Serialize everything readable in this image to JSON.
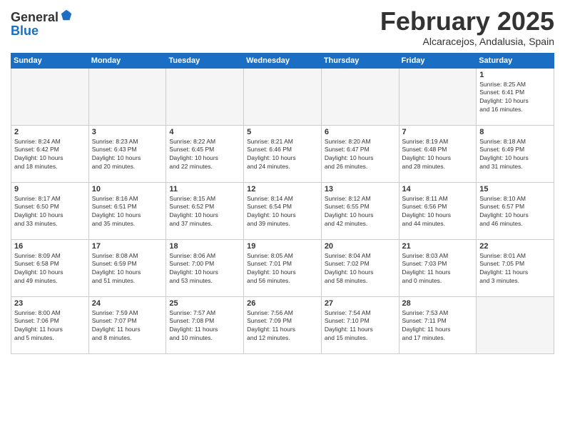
{
  "header": {
    "logo_line1": "General",
    "logo_line2": "Blue",
    "month_title": "February 2025",
    "location": "Alcaracejos, Andalusia, Spain"
  },
  "weekdays": [
    "Sunday",
    "Monday",
    "Tuesday",
    "Wednesday",
    "Thursday",
    "Friday",
    "Saturday"
  ],
  "weeks": [
    [
      {
        "day": "",
        "info": ""
      },
      {
        "day": "",
        "info": ""
      },
      {
        "day": "",
        "info": ""
      },
      {
        "day": "",
        "info": ""
      },
      {
        "day": "",
        "info": ""
      },
      {
        "day": "",
        "info": ""
      },
      {
        "day": "1",
        "info": "Sunrise: 8:25 AM\nSunset: 6:41 PM\nDaylight: 10 hours\nand 16 minutes."
      }
    ],
    [
      {
        "day": "2",
        "info": "Sunrise: 8:24 AM\nSunset: 6:42 PM\nDaylight: 10 hours\nand 18 minutes."
      },
      {
        "day": "3",
        "info": "Sunrise: 8:23 AM\nSunset: 6:43 PM\nDaylight: 10 hours\nand 20 minutes."
      },
      {
        "day": "4",
        "info": "Sunrise: 8:22 AM\nSunset: 6:45 PM\nDaylight: 10 hours\nand 22 minutes."
      },
      {
        "day": "5",
        "info": "Sunrise: 8:21 AM\nSunset: 6:46 PM\nDaylight: 10 hours\nand 24 minutes."
      },
      {
        "day": "6",
        "info": "Sunrise: 8:20 AM\nSunset: 6:47 PM\nDaylight: 10 hours\nand 26 minutes."
      },
      {
        "day": "7",
        "info": "Sunrise: 8:19 AM\nSunset: 6:48 PM\nDaylight: 10 hours\nand 28 minutes."
      },
      {
        "day": "8",
        "info": "Sunrise: 8:18 AM\nSunset: 6:49 PM\nDaylight: 10 hours\nand 31 minutes."
      }
    ],
    [
      {
        "day": "9",
        "info": "Sunrise: 8:17 AM\nSunset: 6:50 PM\nDaylight: 10 hours\nand 33 minutes."
      },
      {
        "day": "10",
        "info": "Sunrise: 8:16 AM\nSunset: 6:51 PM\nDaylight: 10 hours\nand 35 minutes."
      },
      {
        "day": "11",
        "info": "Sunrise: 8:15 AM\nSunset: 6:52 PM\nDaylight: 10 hours\nand 37 minutes."
      },
      {
        "day": "12",
        "info": "Sunrise: 8:14 AM\nSunset: 6:54 PM\nDaylight: 10 hours\nand 39 minutes."
      },
      {
        "day": "13",
        "info": "Sunrise: 8:12 AM\nSunset: 6:55 PM\nDaylight: 10 hours\nand 42 minutes."
      },
      {
        "day": "14",
        "info": "Sunrise: 8:11 AM\nSunset: 6:56 PM\nDaylight: 10 hours\nand 44 minutes."
      },
      {
        "day": "15",
        "info": "Sunrise: 8:10 AM\nSunset: 6:57 PM\nDaylight: 10 hours\nand 46 minutes."
      }
    ],
    [
      {
        "day": "16",
        "info": "Sunrise: 8:09 AM\nSunset: 6:58 PM\nDaylight: 10 hours\nand 49 minutes."
      },
      {
        "day": "17",
        "info": "Sunrise: 8:08 AM\nSunset: 6:59 PM\nDaylight: 10 hours\nand 51 minutes."
      },
      {
        "day": "18",
        "info": "Sunrise: 8:06 AM\nSunset: 7:00 PM\nDaylight: 10 hours\nand 53 minutes."
      },
      {
        "day": "19",
        "info": "Sunrise: 8:05 AM\nSunset: 7:01 PM\nDaylight: 10 hours\nand 56 minutes."
      },
      {
        "day": "20",
        "info": "Sunrise: 8:04 AM\nSunset: 7:02 PM\nDaylight: 10 hours\nand 58 minutes."
      },
      {
        "day": "21",
        "info": "Sunrise: 8:03 AM\nSunset: 7:03 PM\nDaylight: 11 hours\nand 0 minutes."
      },
      {
        "day": "22",
        "info": "Sunrise: 8:01 AM\nSunset: 7:05 PM\nDaylight: 11 hours\nand 3 minutes."
      }
    ],
    [
      {
        "day": "23",
        "info": "Sunrise: 8:00 AM\nSunset: 7:06 PM\nDaylight: 11 hours\nand 5 minutes."
      },
      {
        "day": "24",
        "info": "Sunrise: 7:59 AM\nSunset: 7:07 PM\nDaylight: 11 hours\nand 8 minutes."
      },
      {
        "day": "25",
        "info": "Sunrise: 7:57 AM\nSunset: 7:08 PM\nDaylight: 11 hours\nand 10 minutes."
      },
      {
        "day": "26",
        "info": "Sunrise: 7:56 AM\nSunset: 7:09 PM\nDaylight: 11 hours\nand 12 minutes."
      },
      {
        "day": "27",
        "info": "Sunrise: 7:54 AM\nSunset: 7:10 PM\nDaylight: 11 hours\nand 15 minutes."
      },
      {
        "day": "28",
        "info": "Sunrise: 7:53 AM\nSunset: 7:11 PM\nDaylight: 11 hours\nand 17 minutes."
      },
      {
        "day": "",
        "info": ""
      }
    ]
  ]
}
